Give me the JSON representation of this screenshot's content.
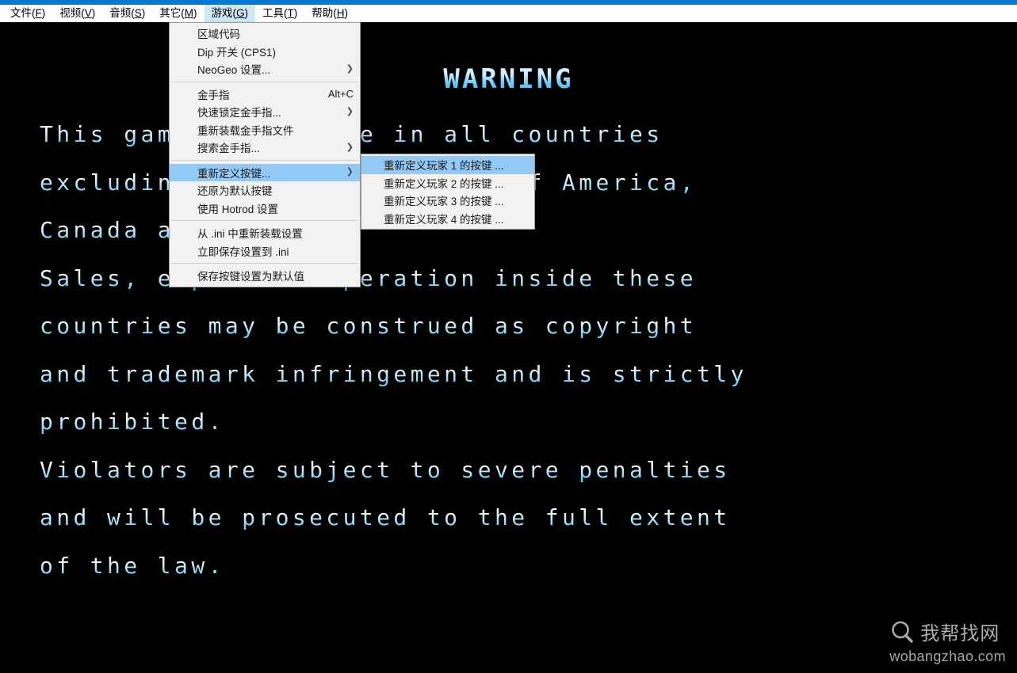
{
  "window": {
    "title_bar_color": "#0078d7",
    "menubar_bg": "#ffffff",
    "highlight_color": "#91c9f7",
    "menubar_active_color": "#cce8f4"
  },
  "menubar": {
    "items": [
      {
        "label": "文件(F)",
        "text": "文件(",
        "mnemonic": "F",
        "tail": ")",
        "active": false
      },
      {
        "label": "视频(V)",
        "text": "视频(",
        "mnemonic": "V",
        "tail": ")",
        "active": false
      },
      {
        "label": "音频(S)",
        "text": "音频(",
        "mnemonic": "S",
        "tail": ")",
        "active": false
      },
      {
        "label": "其它(M)",
        "text": "其它(",
        "mnemonic": "M",
        "tail": ")",
        "active": false
      },
      {
        "label": "游戏(G)",
        "text": "游戏(",
        "mnemonic": "G",
        "tail": ")",
        "active": true
      },
      {
        "label": "工具(T)",
        "text": "工具(",
        "mnemonic": "T",
        "tail": ")",
        "active": false
      },
      {
        "label": "帮助(H)",
        "text": "帮助(",
        "mnemonic": "H",
        "tail": ")",
        "active": false
      }
    ]
  },
  "game_menu": {
    "rows": [
      {
        "label": "区域代码",
        "accel": "",
        "submenu": false,
        "highlight": false
      },
      {
        "label": "Dip 开关 (CPS1)",
        "accel": "",
        "submenu": false,
        "highlight": false
      },
      {
        "label": "NeoGeo 设置...",
        "accel": "",
        "submenu": true,
        "highlight": false
      },
      {
        "separator": true
      },
      {
        "label": "金手指",
        "accel": "Alt+C",
        "submenu": false,
        "highlight": false
      },
      {
        "label": "快速锁定金手指...",
        "accel": "",
        "submenu": true,
        "highlight": false
      },
      {
        "label": "重新装载金手指文件",
        "accel": "",
        "submenu": false,
        "highlight": false
      },
      {
        "label": "搜索金手指...",
        "accel": "",
        "submenu": true,
        "highlight": false
      },
      {
        "separator": true
      },
      {
        "label": "重新定义按键...",
        "accel": "",
        "submenu": true,
        "highlight": true
      },
      {
        "label": "还原为默认按键",
        "accel": "",
        "submenu": false,
        "highlight": false
      },
      {
        "label": "使用 Hotrod 设置",
        "accel": "",
        "submenu": false,
        "highlight": false
      },
      {
        "separator": true
      },
      {
        "label": "从 .ini 中重新装载设置",
        "accel": "",
        "submenu": false,
        "highlight": false
      },
      {
        "label": "立即保存设置到 .ini",
        "accel": "",
        "submenu": false,
        "highlight": false
      },
      {
        "separator": true
      },
      {
        "label": "保存按键设置为默认值",
        "accel": "",
        "submenu": false,
        "highlight": false
      }
    ]
  },
  "redefine_submenu": {
    "rows": [
      {
        "label": "重新定义玩家 1 的按键 ...",
        "highlight": true
      },
      {
        "label": "重新定义玩家 2 的按键 ...",
        "highlight": false
      },
      {
        "label": "重新定义玩家 3 的按键 ...",
        "highlight": false
      },
      {
        "label": "重新定义玩家 4 的按键 ...",
        "highlight": false
      }
    ]
  },
  "game_screen": {
    "title": "WARNING",
    "lines": [
      "This game is for use in all countries",
      "excluding the United States of America,",
      "Canada and Japan.",
      "Sales, export or operation inside these",
      "countries may be construed as copyright",
      "and trademark infringement and is strictly",
      "prohibited.",
      "Violators are subject to severe penalties",
      "and will be prosecuted to the full extent",
      "of the law."
    ]
  },
  "watermark": {
    "icon": "magnifier-icon",
    "chinese": "我帮找网",
    "url": "wobangzhao.com"
  }
}
